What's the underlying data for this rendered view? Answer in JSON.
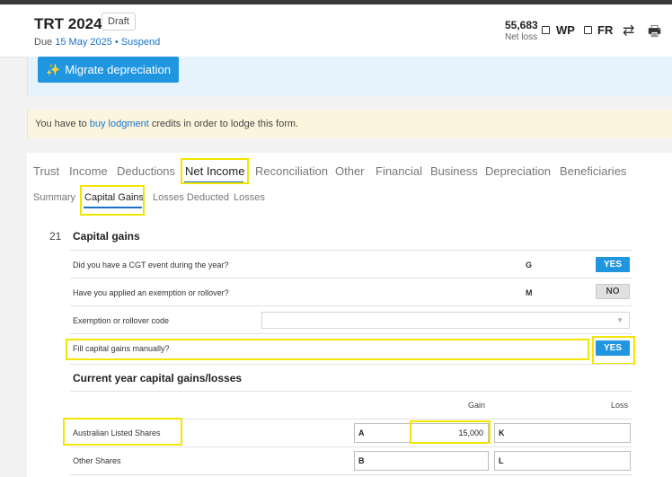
{
  "header": {
    "title": "TRT 2024",
    "status_badge": "Draft",
    "due_prefix": "Due ",
    "due_date": "15 May 2025",
    "due_separator": " • ",
    "suspend_link": "Suspend",
    "net_value": "55,683",
    "net_label": "Net loss",
    "wp_label": "WP",
    "fr_label": "FR",
    "swap_icon": "⇄",
    "print_icon": "🖶"
  },
  "migrate_button": {
    "icon": "✨",
    "label": "Migrate depreciation"
  },
  "notice": {
    "prefix": "You have to ",
    "link": "buy lodgment",
    "suffix": " credits in order to lodge this form."
  },
  "tabs": [
    "Trust",
    "Income",
    "Deductions",
    "Net Income",
    "Reconciliation",
    "Other",
    "Financial",
    "Business",
    "Depreciation",
    "Beneficiaries"
  ],
  "active_tab": "Net Income",
  "subtabs": [
    "Summary",
    "Capital Gains",
    "Losses Deducted",
    "Losses"
  ],
  "active_subtab": "Capital Gains",
  "section": {
    "number": "21",
    "title": "Capital gains",
    "questions": [
      {
        "text": "Did you have a CGT event during the year?",
        "code": "G",
        "answer": "YES"
      },
      {
        "text": "Have you applied an exemption or rollover?",
        "code": "M",
        "answer": "NO"
      },
      {
        "text": "Exemption or rollover code",
        "code": "",
        "answer": ""
      },
      {
        "text": "Fill capital gains manually?",
        "code": "",
        "answer": "YES"
      }
    ],
    "subsection_title": "Current year capital gains/losses",
    "columns": {
      "gain": "Gain",
      "loss": "Loss"
    },
    "rows": [
      {
        "label": "Australian Listed Shares",
        "gain_code": "A",
        "gain_value": "15,000",
        "loss_code": "K",
        "loss_value": ""
      },
      {
        "label": "Other Shares",
        "gain_code": "B",
        "gain_value": "",
        "loss_code": "L",
        "loss_value": ""
      }
    ]
  },
  "colors": {
    "accent": "#2196e0",
    "highlight": "#f2e600",
    "info_banner": "#e7f3fc",
    "warning_banner": "#fcf5dd"
  }
}
